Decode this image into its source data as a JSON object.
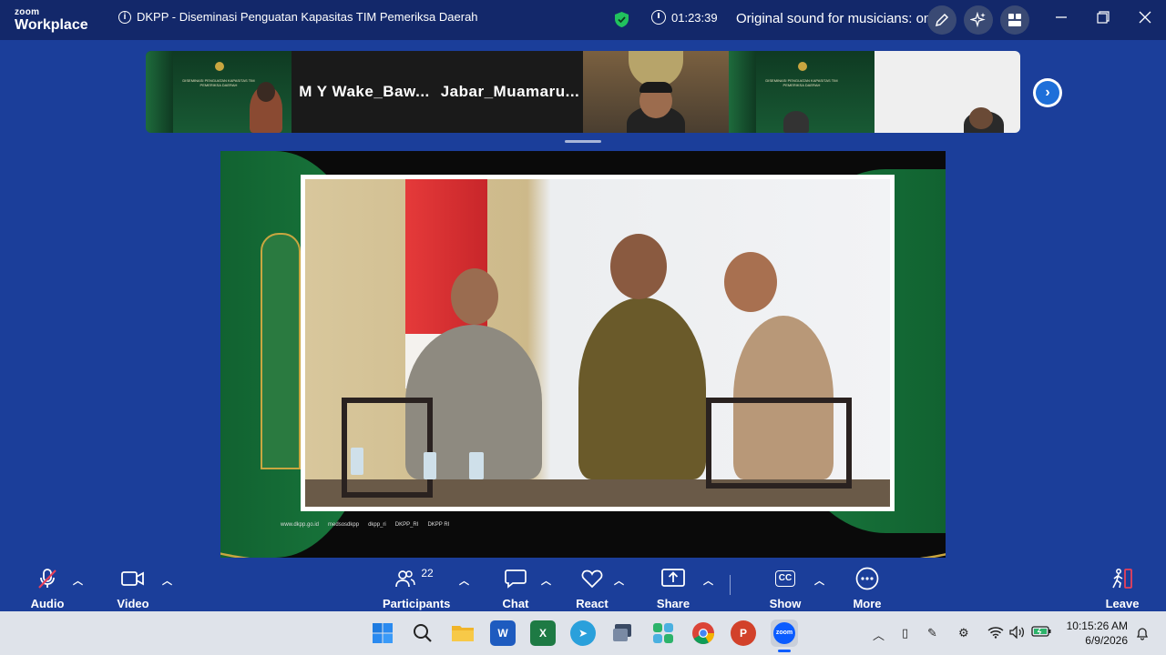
{
  "app": {
    "brand_small": "zoom",
    "brand_big": "Workplace"
  },
  "meeting": {
    "title": "DKPP - Diseminasi Penguatan Kapasitas TIM Pemeriksa Daerah",
    "elapsed": "01:23:39",
    "original_sound": "Original sound for musicians: on"
  },
  "strip": {
    "tiles": [
      {
        "type": "slide",
        "text": "DISEMINASI PENGUATAN KAPASITAS TIM PEMERIKSA DAERAH"
      },
      {
        "type": "name",
        "label": "M Y Wake_Baw..."
      },
      {
        "type": "name",
        "label": "Jabar_Muamaru..."
      },
      {
        "type": "camera"
      },
      {
        "type": "slide",
        "text": "DISEMINASI PENGUATAN KAPASITAS TIM PEMERIKSA DAERAH"
      },
      {
        "type": "camera-white"
      }
    ]
  },
  "share": {
    "footer": [
      "www.dkpp.go.id",
      "medsosdkpp",
      "dkpp_ri",
      "DKPP_RI",
      "DKPP RI"
    ]
  },
  "toolbar": {
    "audio": "Audio",
    "video": "Video",
    "participants": "Participants",
    "participants_count": "22",
    "chat": "Chat",
    "react": "React",
    "share": "Share",
    "captions": "Show captions",
    "captions_icon": "CC",
    "more": "More",
    "leave": "Leave"
  },
  "taskbar": {
    "time": "10:15:26 AM",
    "date": "6/9/2026",
    "zoom_icon": "zoom"
  },
  "colors": {
    "accent": "#1e6fd9",
    "background": "#1b3e9a",
    "titlebar": "#13286a",
    "mute_red": "#e8405a"
  }
}
